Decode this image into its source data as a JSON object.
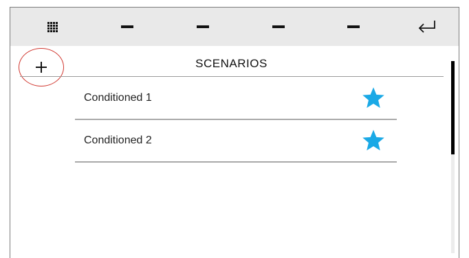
{
  "header": {
    "buttons": [
      {
        "icon": "grid-menu-icon"
      },
      {
        "icon": "dash-icon"
      },
      {
        "icon": "dash-icon"
      },
      {
        "icon": "dash-icon"
      },
      {
        "icon": "dash-icon"
      },
      {
        "icon": "return-icon"
      }
    ]
  },
  "add_button": {
    "icon": "plus-icon",
    "highlight_color": "#d0342c"
  },
  "page": {
    "title": "SCENARIOS"
  },
  "scenarios": [
    {
      "label": "Conditioned 1",
      "favorite": true
    },
    {
      "label": "Conditioned 2",
      "favorite": true
    }
  ],
  "colors": {
    "topbar_bg": "#e9e9e9",
    "star": "#1aa9e6",
    "divider": "#a8a8a8"
  }
}
